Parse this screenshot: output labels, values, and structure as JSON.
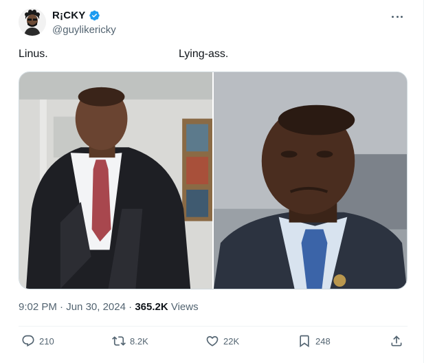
{
  "author": {
    "display_name": "R¡CKY",
    "handle": "@guylikericky",
    "verified": true
  },
  "tweet": {
    "text_left": "Linus.",
    "text_right": "Lying-ass."
  },
  "meta": {
    "time": "9:02 PM",
    "separator": " · ",
    "date": "Jun 30, 2024",
    "views_count": "365.2K",
    "views_label": "Views"
  },
  "actions": {
    "replies": "210",
    "reposts": "8.2K",
    "likes": "22K",
    "bookmarks": "248"
  },
  "icons": [
    "verified-badge-icon",
    "more-icon",
    "reply-icon",
    "retweet-icon",
    "like-icon",
    "bookmark-icon",
    "share-icon"
  ],
  "colors": {
    "verified": "#1d9bf0",
    "text": "#0f1419",
    "secondary": "#536471",
    "divider": "#eff3f4"
  }
}
